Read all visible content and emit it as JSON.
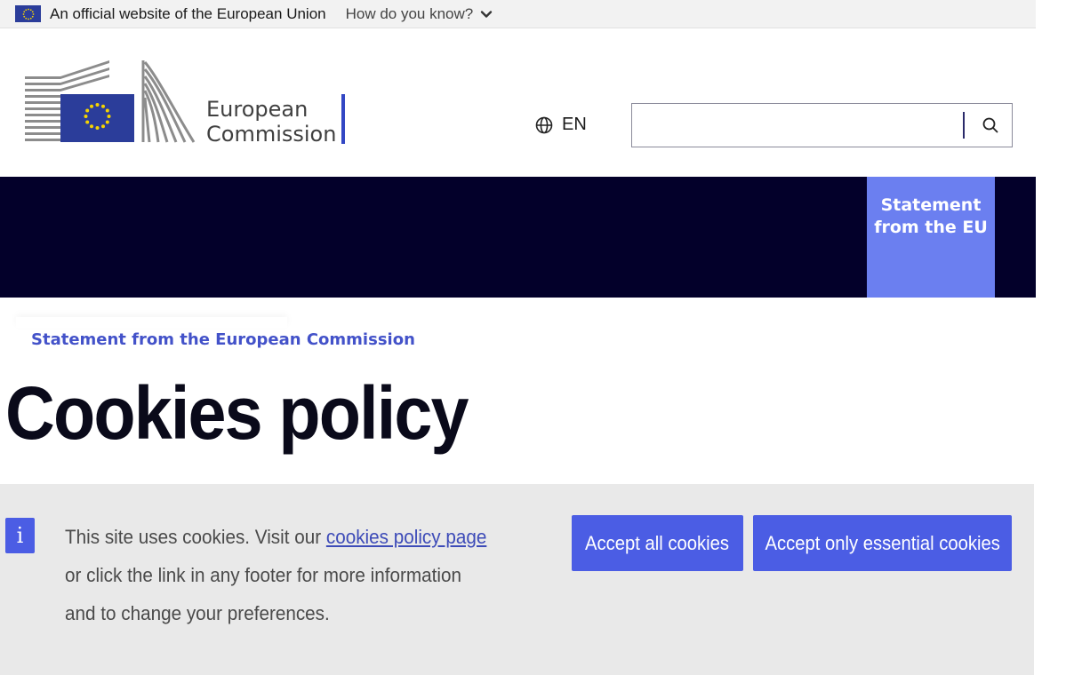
{
  "official_bar": {
    "text": "An official website of the European Union",
    "how_know": "How do you know?"
  },
  "header": {
    "logo_line1": "European",
    "logo_line2": "Commission",
    "language": "EN",
    "search_placeholder": ""
  },
  "nav": {
    "tab_line1": "Statement",
    "tab_line2": "from the EU"
  },
  "breadcrumb": "Statement from the European Commission",
  "page_title": "Cookies policy",
  "cookie_banner": {
    "info_glyph": "i",
    "text_before_link": "This site uses cookies. Visit our ",
    "link_text": "cookies policy page",
    "line2": "or click the link in any footer for more information",
    "line3": "and to change your preferences.",
    "accept_all": "Accept all cookies",
    "accept_essential": "Accept only essential cookies"
  },
  "colors": {
    "nav_band": "#03002a",
    "accent": "#4b5de4",
    "nav_tab": "#6b7ff0",
    "breadcrumb": "#4352c9",
    "banner_bg": "#e9e9e9"
  }
}
